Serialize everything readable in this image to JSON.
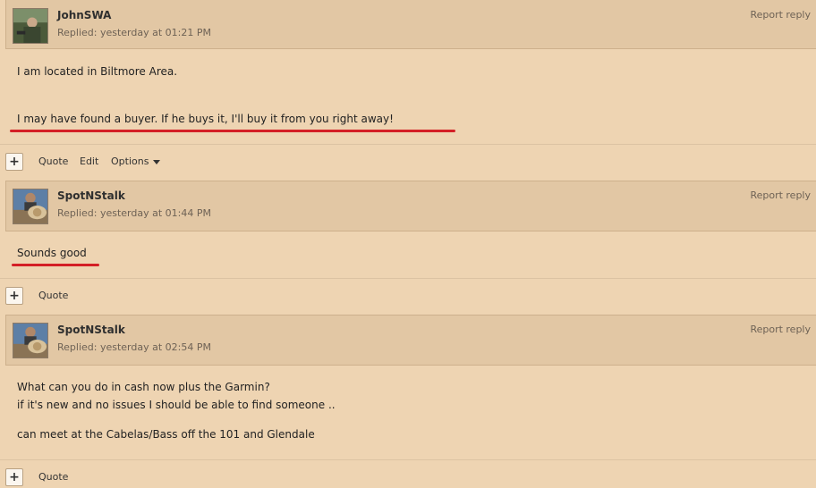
{
  "posts": [
    {
      "username": "JohnSWA",
      "replied": "Replied: yesterday at 01:21 PM",
      "report": "Report reply",
      "lines": [
        "I am located in Biltmore Area.",
        "I may have found a buyer. If he buys it, I'll buy it from you right away!"
      ],
      "actions": [
        "Quote",
        "Edit",
        "Options"
      ]
    },
    {
      "username": "SpotNStalk",
      "replied": "Replied: yesterday at 01:44 PM",
      "report": "Report reply",
      "lines": [
        "Sounds good"
      ],
      "actions": [
        "Quote"
      ]
    },
    {
      "username": "SpotNStalk",
      "replied": "Replied: yesterday at 02:54 PM",
      "report": "Report reply",
      "lines": [
        "What can you do in cash now plus the Garmin?",
        "if it's new and no issues I should be able to find someone ..",
        "can meet at the Cabelas/Bass off the 101 and Glendale"
      ],
      "actions": [
        "Quote"
      ]
    }
  ],
  "plus_label": "+",
  "colors": {
    "background": "#eed4b2",
    "header": "#e2c7a4",
    "annotation": "#d41f26"
  }
}
